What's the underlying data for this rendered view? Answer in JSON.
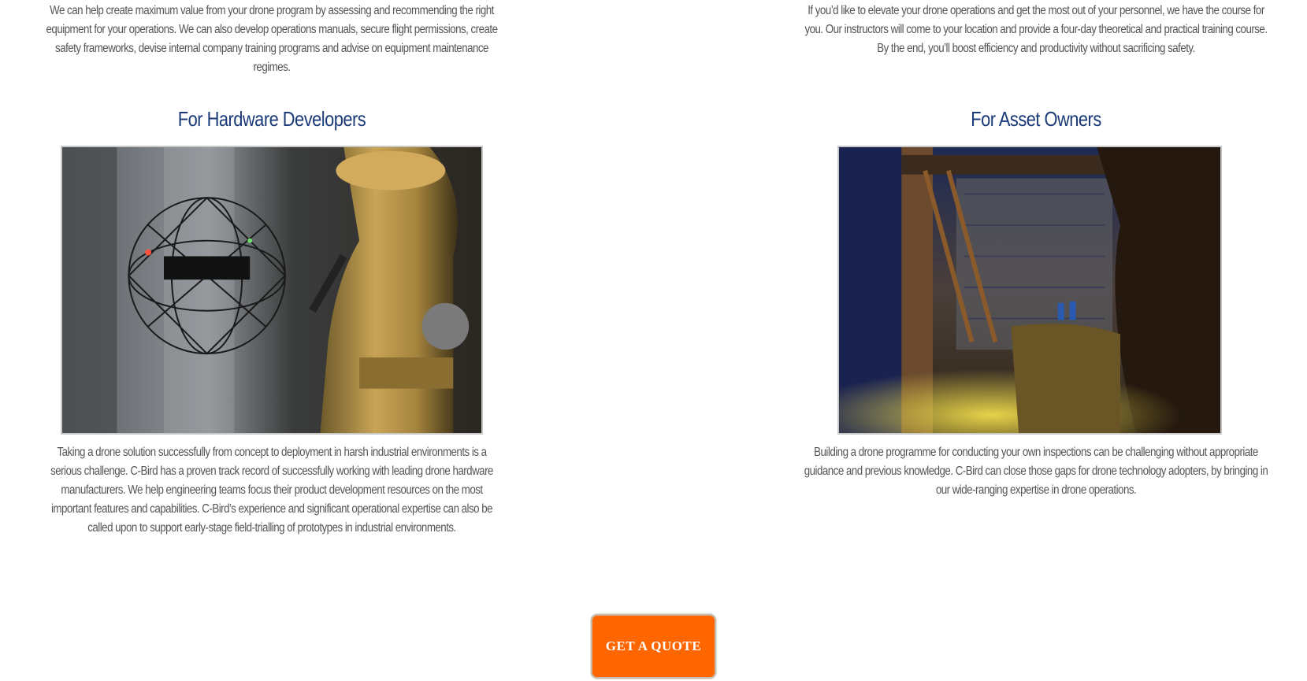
{
  "left": {
    "top_text": "We can help create maximum value from your drone program by assessing and recommending the right equipment for your operations. We can also develop operations manuals, secure flight permissions, create safety frameworks, devise internal company training programs and advise on equipment maintenance regimes.",
    "heading": "For Hardware Developers",
    "bottom_text": "Taking a drone solution successfully from concept to deployment in harsh industrial environments is a serious challenge. C-Bird has a proven track record of successfully working with leading drone hardware manufacturers. We help engineering teams focus their product development resources on the most important features and capabilities. C-Bird’s experience and significant operational expertise can also be called upon to support early-stage field-trialling of prototypes in industrial environments."
  },
  "right": {
    "top_text": "If you’d like to elevate your drone operations and get the most out of your personnel, we have the course for you. Our instructors will come to your location and provide a four-day theoretical and practical training course. By the end, you’ll boost efficiency and productivity without sacrificing safety.",
    "heading": "For Asset Owners",
    "bottom_text": "Building a drone programme for conducting your own inspections can be challenging without appropriate guidance and previous knowledge. C-Bird can close those gaps for drone technology adopters, by bringing in our wide-ranging expertise in drone operations."
  },
  "cta": {
    "label": "GET A QUOTE"
  },
  "colors": {
    "heading": "#1b3a78",
    "body_text": "#555555",
    "button": "#ff6600"
  }
}
